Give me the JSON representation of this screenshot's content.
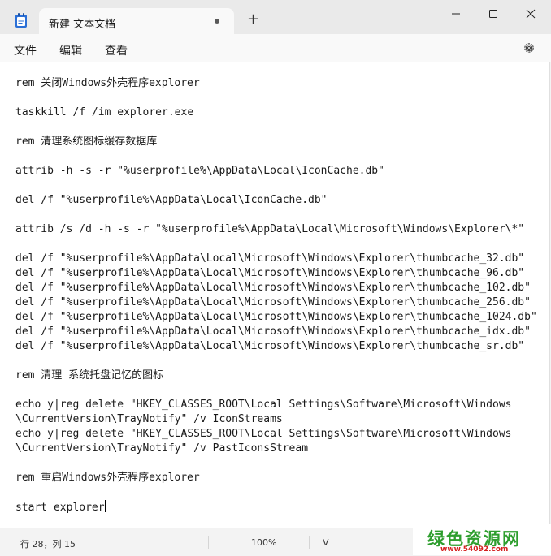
{
  "window": {
    "tab_title": "新建 文本文档",
    "add_tab": "+"
  },
  "menu": {
    "file": "文件",
    "edit": "编辑",
    "view": "查看"
  },
  "editor": {
    "lines": [
      "rem 关闭Windows外壳程序explorer",
      "",
      "taskkill /f /im explorer.exe",
      "",
      "rem 清理系统图标缓存数据库",
      "",
      "attrib -h -s -r \"%userprofile%\\AppData\\Local\\IconCache.db\"",
      "",
      "del /f \"%userprofile%\\AppData\\Local\\IconCache.db\"",
      "",
      "attrib /s /d -h -s -r \"%userprofile%\\AppData\\Local\\Microsoft\\Windows\\Explorer\\*\"",
      "",
      "del /f \"%userprofile%\\AppData\\Local\\Microsoft\\Windows\\Explorer\\thumbcache_32.db\"",
      "del /f \"%userprofile%\\AppData\\Local\\Microsoft\\Windows\\Explorer\\thumbcache_96.db\"",
      "del /f \"%userprofile%\\AppData\\Local\\Microsoft\\Windows\\Explorer\\thumbcache_102.db\"",
      "del /f \"%userprofile%\\AppData\\Local\\Microsoft\\Windows\\Explorer\\thumbcache_256.db\"",
      "del /f \"%userprofile%\\AppData\\Local\\Microsoft\\Windows\\Explorer\\thumbcache_1024.db\"",
      "del /f \"%userprofile%\\AppData\\Local\\Microsoft\\Windows\\Explorer\\thumbcache_idx.db\"",
      "del /f \"%userprofile%\\AppData\\Local\\Microsoft\\Windows\\Explorer\\thumbcache_sr.db\"",
      "",
      "rem 清理 系统托盘记忆的图标",
      "",
      "echo y|reg delete \"HKEY_CLASSES_ROOT\\Local Settings\\Software\\Microsoft\\Windows",
      "\\CurrentVersion\\TrayNotify\" /v IconStreams",
      "echo y|reg delete \"HKEY_CLASSES_ROOT\\Local Settings\\Software\\Microsoft\\Windows",
      "\\CurrentVersion\\TrayNotify\" /v PastIconsStream",
      "",
      "rem 重启Windows外壳程序explorer",
      "",
      "start explorer"
    ]
  },
  "status": {
    "position": "行 28，列 15",
    "zoom": "100%",
    "more": "V"
  },
  "watermark": {
    "name": "绿色资源网",
    "url": "www.54092.com"
  },
  "icons": {
    "app": "notepad-icon",
    "tab_modified": "unsaved-dot-icon",
    "minimize": "minimize-icon",
    "maximize": "maximize-icon",
    "close": "close-icon",
    "settings": "gear-icon"
  },
  "colors": {
    "accent": "#2b6fd6",
    "watermark_green": "#2e9e2e",
    "watermark_red": "#d42020"
  }
}
